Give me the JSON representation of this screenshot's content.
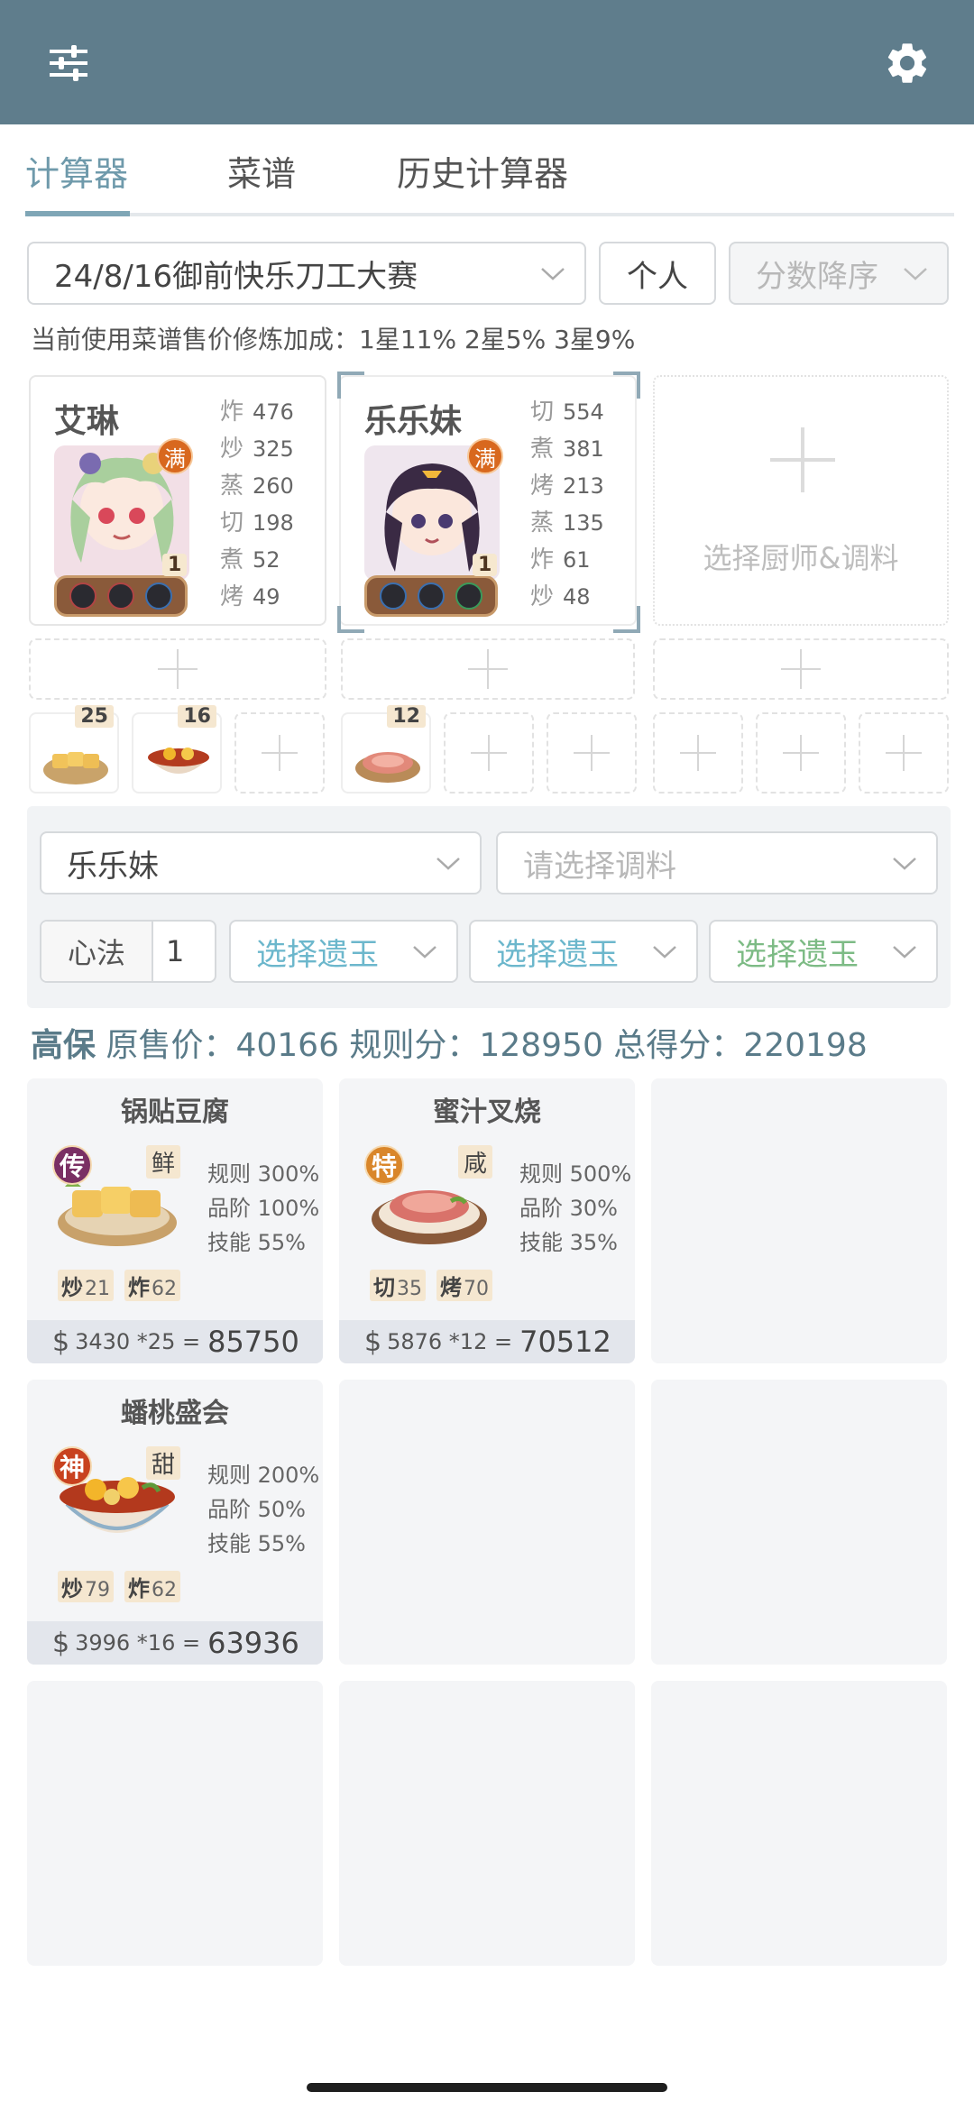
{
  "tabs": [
    "计算器",
    "菜谱",
    "历史计算器"
  ],
  "controls": {
    "contest": "24/8/16御前快乐刀工大赛",
    "mode": "个人",
    "sort": "分数降序"
  },
  "note": "当前使用菜谱售价修炼加成：1星11% 2星5% 3星9%",
  "chefs": [
    {
      "name": "艾琳",
      "badge": "满",
      "level": "1",
      "stats": [
        {
          "k": "炸",
          "v": "476"
        },
        {
          "k": "炒",
          "v": "325"
        },
        {
          "k": "蒸",
          "v": "260"
        },
        {
          "k": "切",
          "v": "198"
        },
        {
          "k": "煮",
          "v": "52"
        },
        {
          "k": "烤",
          "v": "49"
        }
      ]
    },
    {
      "name": "乐乐妹",
      "badge": "满",
      "level": "1",
      "stats": [
        {
          "k": "切",
          "v": "554"
        },
        {
          "k": "煮",
          "v": "381"
        },
        {
          "k": "烤",
          "v": "213"
        },
        {
          "k": "蒸",
          "v": "135"
        },
        {
          "k": "炸",
          "v": "61"
        },
        {
          "k": "炒",
          "v": "48"
        }
      ]
    }
  ],
  "empty_chef_label": "选择厨师&调料",
  "equip_qty": [
    "25",
    "16",
    "12"
  ],
  "panel": {
    "chef_select": "乐乐妹",
    "seasoning_placeholder": "请选择调料",
    "xinfa_label": "心法",
    "xinfa_value": "1",
    "relic_1": "选择遗玉",
    "relic_2": "选择遗玉",
    "relic_3": "选择遗玉"
  },
  "summary": {
    "tag": "高保",
    "text": "原售价：40166 规则分：128950 总得分：220198"
  },
  "dishes": [
    {
      "name": "锅贴豆腐",
      "rarity": "传",
      "flavor": "鲜",
      "rule": "规则 300%",
      "grade": "品阶 100%",
      "skill": "技能 55%",
      "tags": [
        {
          "k": "炒",
          "v": "21"
        },
        {
          "k": "炸",
          "v": "62"
        }
      ],
      "price_calc": "3430 *25 =",
      "total": "85750"
    },
    {
      "name": "蜜汁叉烧",
      "rarity": "特",
      "flavor": "咸",
      "rule": "规则 500%",
      "grade": "品阶 30%",
      "skill": "技能 35%",
      "tags": [
        {
          "k": "切",
          "v": "35"
        },
        {
          "k": "烤",
          "v": "70"
        }
      ],
      "price_calc": "5876 *12 =",
      "total": "70512"
    },
    {
      "name": "蟠桃盛会",
      "rarity": "神",
      "flavor": "甜",
      "rule": "规则 200%",
      "grade": "品阶 50%",
      "skill": "技能 55%",
      "tags": [
        {
          "k": "炒",
          "v": "79"
        },
        {
          "k": "炸",
          "v": "62"
        }
      ],
      "price_calc": "3996 *16 =",
      "total": "63936"
    }
  ],
  "price_symbol": "$",
  "colors": {
    "appbar": "#5f7d8c",
    "accent": "#7fa6b6",
    "rarity_chuan": "#7a2f63",
    "rarity_te": "#d9862a",
    "rarity_shen": "#c8421f"
  },
  "icons": {
    "menu": "sliders-icon",
    "settings": "gear-icon"
  }
}
